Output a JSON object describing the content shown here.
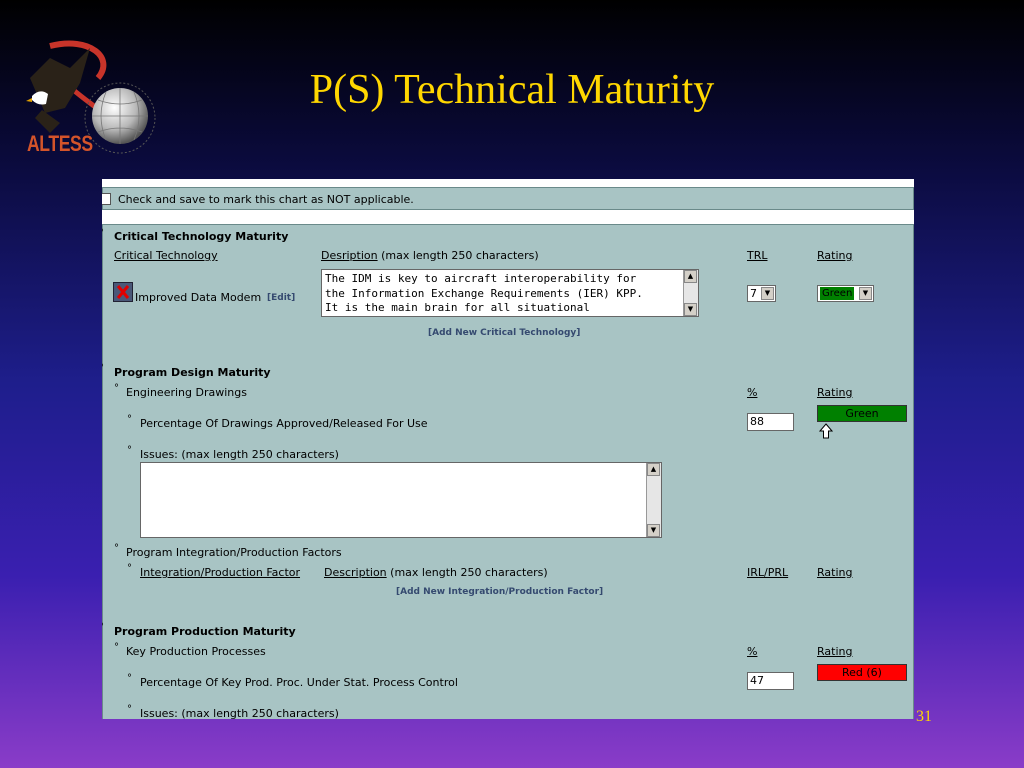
{
  "slide": {
    "title": "P(S) Technical Maturity",
    "page_number": "31",
    "logo_text": "ALTESS",
    "colors": {
      "title": "#ffd700",
      "green": "#008000",
      "red": "#ff0000"
    }
  },
  "form": {
    "na_label": "Check and save to mark this chart as NOT applicable.",
    "critical": {
      "heading": "Critical Technology Maturity",
      "col_technology": "Critical Technology",
      "col_description": "Desription",
      "col_description_note": "(max length 250 characters)",
      "col_trl": "TRL",
      "col_rating": "Rating",
      "item_icon": "delete-x-icon",
      "item_name": "Improved Data Modem",
      "edit_link": "[Edit]",
      "description_text": "The IDM is key to aircraft interoperability for\nthe Information Exchange Requirements (IER) KPP.\nIt is the main brain for all situational",
      "trl_value": "7",
      "rating_value": "Green",
      "add_link": "[Add New Critical Technology]"
    },
    "design": {
      "heading": "Program Design Maturity",
      "sub_heading": "Engineering Drawings",
      "col_percent": "%",
      "col_rating": "Rating",
      "metric_label": "Percentage Of Drawings Approved/Released For Use",
      "metric_value": "88",
      "metric_rating": "Green",
      "arrow_icon": "up-arrow-icon",
      "issues_label": "Issues: (max length 250 characters)",
      "issues_text": ""
    },
    "integration": {
      "heading": "Program Integration/Production Factors",
      "col_factor": "Integration/Production Factor",
      "col_description": "Description",
      "col_description_note": "(max length 250 characters)",
      "col_irl": "IRL/PRL",
      "col_rating": "Rating",
      "add_link": "[Add New Integration/Production Factor]"
    },
    "production": {
      "heading": "Program Production Maturity",
      "sub_heading": "Key Production Processes",
      "col_percent": "%",
      "col_rating": "Rating",
      "metric_label": "Percentage Of Key Prod. Proc. Under Stat. Process Control",
      "metric_value": "47",
      "metric_rating": "Red (6)",
      "issues_label": "Issues: (max length 250 characters)"
    }
  }
}
